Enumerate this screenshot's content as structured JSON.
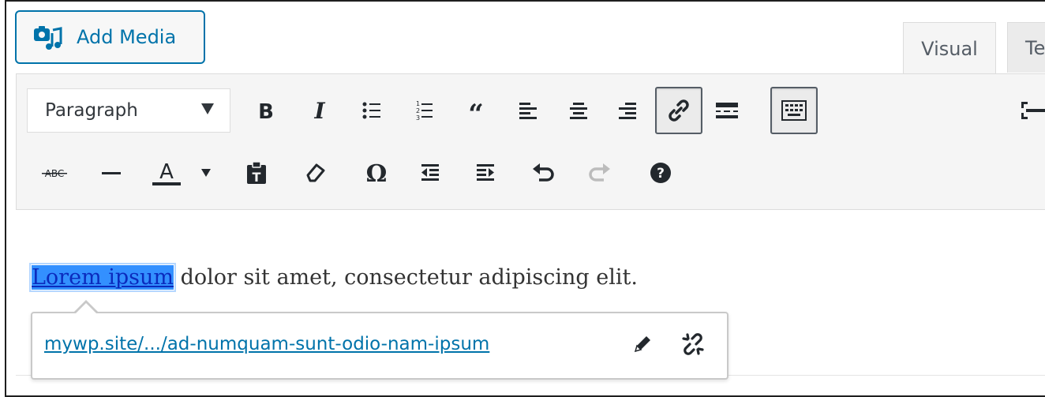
{
  "media": {
    "add_media_label": "Add Media"
  },
  "tabs": [
    {
      "label": "Visual",
      "active": true
    },
    {
      "label": "Te",
      "active": false
    }
  ],
  "toolbar": {
    "format_select_value": "Paragraph",
    "row1_icons": [
      "bold-icon",
      "italic-icon",
      "bulleted-list-icon",
      "numbered-list-icon",
      "blockquote-icon",
      "align-left-icon",
      "align-center-icon",
      "align-right-icon",
      "insert-link-icon",
      "read-more-icon",
      "toolbar-toggle-icon",
      "fullscreen-icon"
    ],
    "row2_icons": [
      "strikethrough-icon",
      "horizontal-line-icon",
      "text-color-icon",
      "paste-as-text-icon",
      "clear-formatting-icon",
      "special-character-icon",
      "decrease-indent-icon",
      "increase-indent-icon",
      "undo-icon",
      "redo-icon",
      "keyboard-shortcuts-icon"
    ],
    "active_button": "insert-link-icon"
  },
  "editor": {
    "linked_text": "Lorem ipsum",
    "rest_text": " dolor sit amet, consectetur adipiscing elit."
  },
  "link_popup": {
    "url_display": "mywp.site/.../ad-numquam-sunt-odio-nam-ipsum",
    "icons": [
      "edit-link-icon",
      "remove-link-icon"
    ]
  },
  "colors": {
    "accent": "#0073aa",
    "selection": "#3390ff",
    "toolbar_bg": "#f5f5f5",
    "icon": "#23282d"
  }
}
